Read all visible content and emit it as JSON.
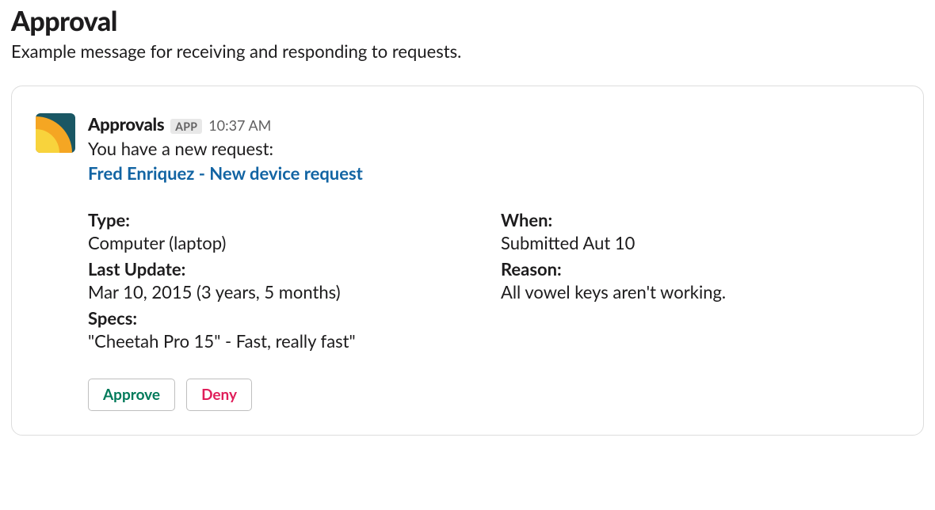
{
  "page": {
    "title": "Approval",
    "subtitle": "Example message for receiving and responding to requests."
  },
  "message": {
    "app_name": "Approvals",
    "app_badge": "APP",
    "timestamp": "10:37 AM",
    "intro": "You have a new request:",
    "request_link": "Fred Enriquez - New device request",
    "fields": {
      "type": {
        "label": "Type:",
        "value": "Computer (laptop)"
      },
      "when": {
        "label": "When:",
        "value": "Submitted Aut 10"
      },
      "last_update": {
        "label": "Last Update:",
        "value": "Mar 10, 2015 (3 years, 5 months)"
      },
      "reason": {
        "label": "Reason:",
        "value": "All vowel keys aren't working."
      },
      "specs": {
        "label": "Specs:",
        "value": "\"Cheetah Pro 15\" - Fast, really fast\""
      }
    },
    "actions": {
      "approve": "Approve",
      "deny": "Deny"
    }
  },
  "icons": {
    "avatar": "approvals-app-icon"
  },
  "colors": {
    "link": "#1264a3",
    "approve": "#007a5a",
    "deny": "#e01e5a",
    "avatar_bg": "#1a5764",
    "avatar_orange": "#f5a623",
    "avatar_yellow": "#f8d33c"
  }
}
